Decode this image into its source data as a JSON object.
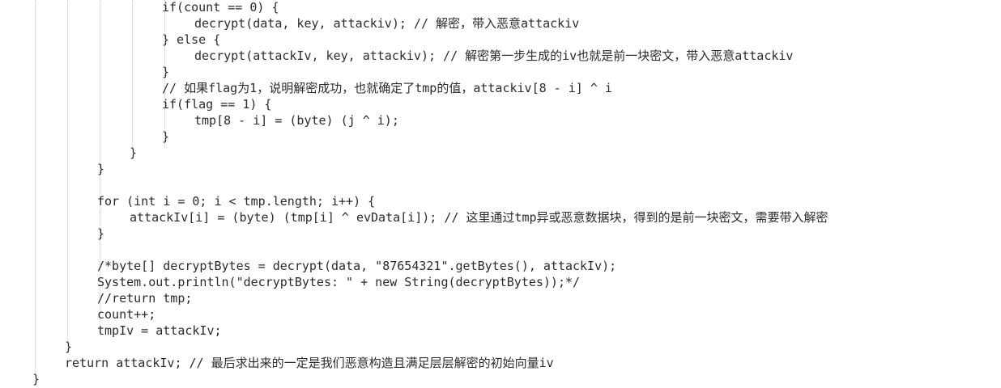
{
  "code": {
    "lines": [
      {
        "indent": 5,
        "text": "if(count == 0) {"
      },
      {
        "indent": 6,
        "text": "decrypt(data, key, attackiv); // 解密，带入恶意attackiv"
      },
      {
        "indent": 5,
        "text": "} else {"
      },
      {
        "indent": 6,
        "text": "decrypt(attackIv, key, attackiv); // 解密第一步生成的iv也就是前一块密文，带入恶意attackiv"
      },
      {
        "indent": 5,
        "text": "}"
      },
      {
        "indent": 5,
        "text": "// 如果flag为1，说明解密成功，也就确定了tmp的值，attackiv[8 - i] ^ i"
      },
      {
        "indent": 5,
        "text": "if(flag == 1) {"
      },
      {
        "indent": 6,
        "text": "tmp[8 - i] = (byte) (j ^ i);"
      },
      {
        "indent": 5,
        "text": "}"
      },
      {
        "indent": 4,
        "text": "}"
      },
      {
        "indent": 3,
        "text": "}"
      },
      {
        "indent": 0,
        "text": ""
      },
      {
        "indent": 3,
        "text": "for (int i = 0; i < tmp.length; i++) {"
      },
      {
        "indent": 4,
        "text": "attackIv[i] = (byte) (tmp[i] ^ evData[i]); // 这里通过tmp异或恶意数据块，得到的是前一块密文，需要带入解密"
      },
      {
        "indent": 3,
        "text": "}"
      },
      {
        "indent": 0,
        "text": ""
      },
      {
        "indent": 3,
        "text": "/*byte[] decryptBytes = decrypt(data, \"87654321\".getBytes(), attackIv);"
      },
      {
        "indent": 3,
        "text": "System.out.println(\"decryptBytes: \" + new String(decryptBytes));*/"
      },
      {
        "indent": 3,
        "text": "//return tmp;"
      },
      {
        "indent": 3,
        "text": "count++;"
      },
      {
        "indent": 3,
        "text": "tmpIv = attackIv;"
      },
      {
        "indent": 2,
        "text": "}"
      },
      {
        "indent": 2,
        "text": "return attackIv; // 最后求出来的一定是我们恶意构造且满足层层解密的初始向量iv"
      },
      {
        "indent": 1,
        "text": "}"
      }
    ]
  }
}
